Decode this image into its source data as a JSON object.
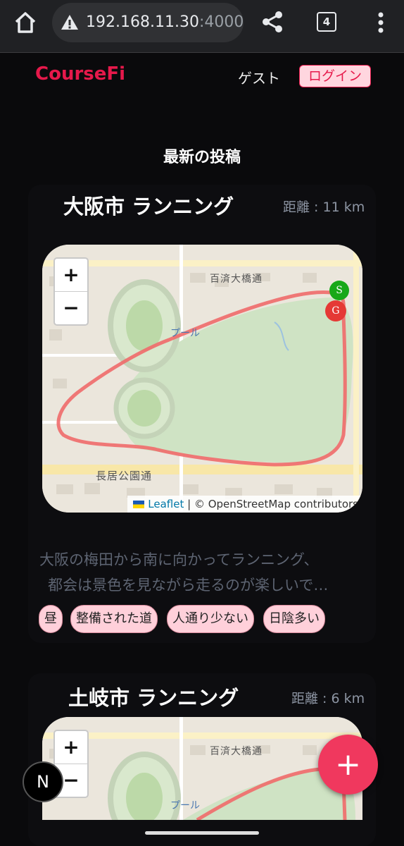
{
  "browser": {
    "url_host": "192.168.11.30",
    "url_port": ":4000",
    "tab_count": "4",
    "icons": [
      "home-icon",
      "warning-icon",
      "share-icon",
      "tabs-icon",
      "more-icon"
    ]
  },
  "header": {
    "brand": "CourseFi",
    "guest": "ゲスト",
    "login": "ログイン"
  },
  "section_title": "最新の投稿",
  "posts": [
    {
      "title": "大阪市 ランニング",
      "distance": "距離 : 11 km",
      "map": {
        "zoom_in": "+",
        "zoom_out": "−",
        "labels": {
          "street1": "百済大橋通",
          "pool": "プール",
          "street2": "長居公園通"
        },
        "start_marker": "S",
        "goal_marker": "G",
        "attribution_link": "Leaflet",
        "attribution_rest": "| © OpenStreetMap contributors",
        "route_color": "#f06a6a"
      },
      "description": "大阪の梅田から南に向かってランニング、都会は景色を見ながら走るのが楽しいで…",
      "description_line1": "大阪の梅田から南に向かってランニング、",
      "description_line2": "都会は景色を見ながら走るのが楽しいで…",
      "tags": [
        "昼",
        "整備された道",
        "人通り少ない",
        "日陰多い"
      ]
    },
    {
      "title": "土岐市 ランニング",
      "distance": "距離 : 6 km",
      "map": {
        "zoom_in": "+",
        "zoom_out": "−",
        "labels": {
          "street1": "百済大橋通",
          "pool": "プール"
        }
      }
    }
  ],
  "fab": {
    "label": "+",
    "icon": "plus-icon"
  },
  "next_badge": "N",
  "colors": {
    "accent": "#e6194b",
    "tag_bg": "#ffd0da",
    "fab": "#f0385e"
  }
}
